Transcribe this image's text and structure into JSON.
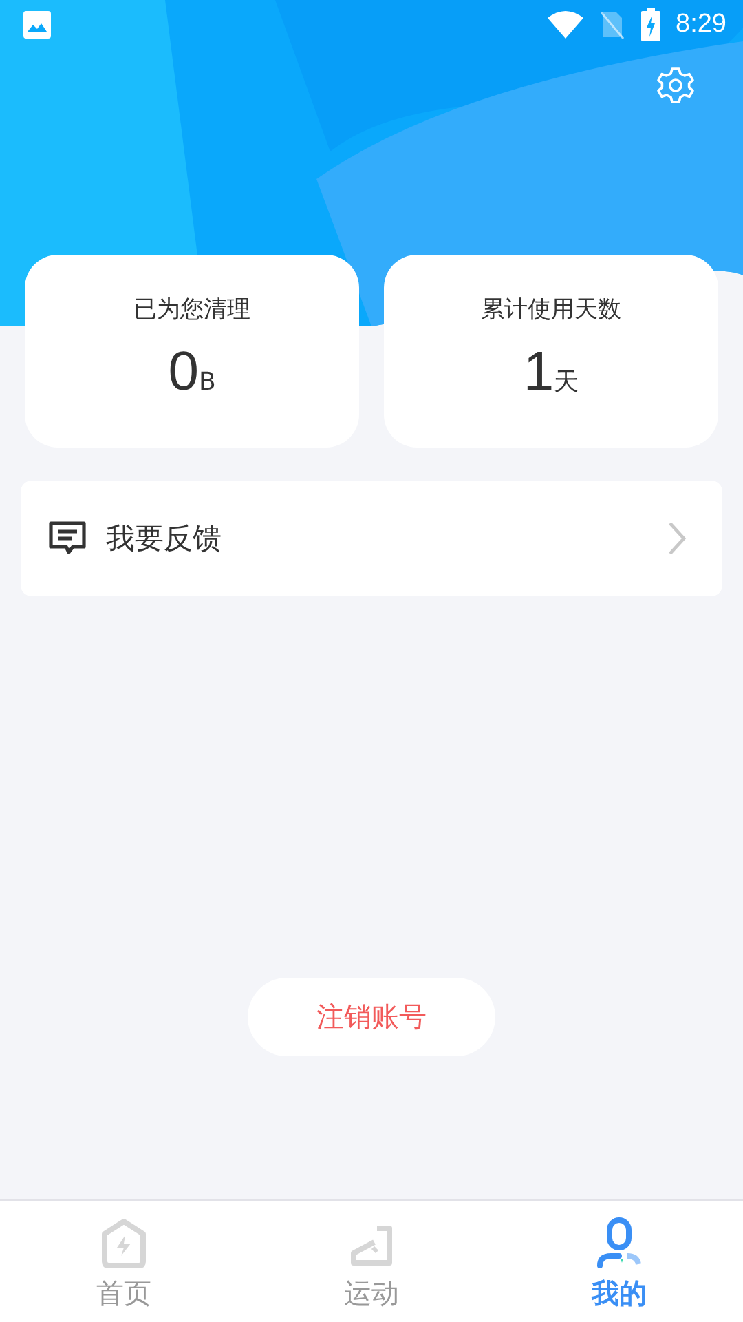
{
  "status_bar": {
    "time": "8:29"
  },
  "stats": [
    {
      "label": "已为您清理",
      "value": "0",
      "unit": "B"
    },
    {
      "label": "累计使用天数",
      "value": "1",
      "unit": "天"
    }
  ],
  "menu": [
    {
      "label": "我要反馈"
    }
  ],
  "logout_button": "注销账号",
  "nav": [
    {
      "label": "首页",
      "selected": false
    },
    {
      "label": "运动",
      "selected": false
    },
    {
      "label": "我的",
      "selected": true
    }
  ]
}
